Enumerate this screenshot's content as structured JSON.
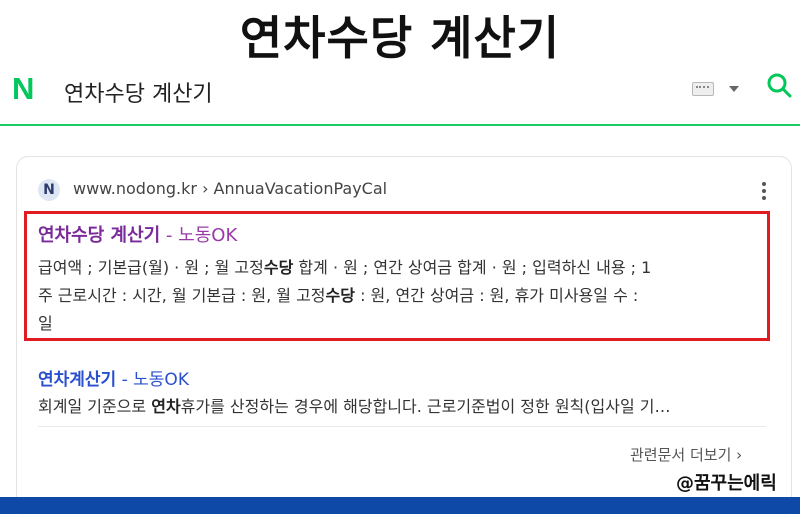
{
  "banner": {
    "title": "연차수당 계산기"
  },
  "search": {
    "logo": "N",
    "query": "연차수당 계산기",
    "keyboard_icon": "keyboard-icon",
    "search_icon": "search-icon"
  },
  "results": [
    {
      "favicon": "N",
      "url": "www.nodong.kr › AnnuaVacationPayCal",
      "title": "연차수당 계산기",
      "sep": "-",
      "source": "노동OK",
      "desc_line1_a": "급여액 ; 기본급(월) · 원 ; 월 고정",
      "desc_line1_b": "수당",
      "desc_line1_c": " 합계 · 원 ; 연간 상여금 합계 · 원 ; 입력하신 내용 ; 1",
      "desc_line2_a": "주 근로시간 : 시간, 월 기본급 : 원, 월 고정",
      "desc_line2_b": "수당",
      "desc_line2_c": " : 원, 연간 상여금 : 원, 휴가 미사용일 수 :",
      "desc_line3": "일"
    },
    {
      "title": "연차계산기",
      "sep": "-",
      "source": "노동OK",
      "desc_a": "회계일 기준으로 ",
      "desc_b": "연차",
      "desc_c": "휴가를 산정하는 경우에 해당합니다. 근로기준법이 정한 원칙(입사일 기…"
    }
  ],
  "more_link": "관련문서 더보기 ›",
  "watermark": "@꿈꾸는에릭",
  "colors": {
    "accent": "#03c75a",
    "highlight": "#e01b22",
    "bar": "#0f49a8"
  }
}
